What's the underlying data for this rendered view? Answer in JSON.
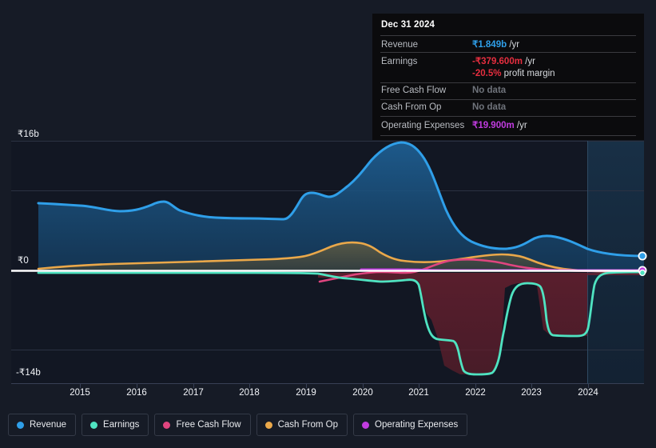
{
  "tooltip": {
    "date": "Dec 31 2024",
    "rows": [
      {
        "key": "Revenue",
        "value": "₹1.849b",
        "suffix": " /yr",
        "color": "blue"
      },
      {
        "key": "Earnings",
        "value": "-₹379.600m",
        "suffix": " /yr",
        "color": "red"
      },
      {
        "key": "",
        "value": "-20.5%",
        "suffix": " profit margin",
        "color": "red"
      },
      {
        "key": "Free Cash Flow",
        "value": "No data",
        "suffix": "",
        "color": "muted"
      },
      {
        "key": "Cash From Op",
        "value": "No data",
        "suffix": "",
        "color": "muted"
      },
      {
        "key": "Operating Expenses",
        "value": "₹19.900m",
        "suffix": " /yr",
        "color": "purple"
      }
    ]
  },
  "axis": {
    "y_top": "₹16b",
    "y_zero": "₹0",
    "y_bottom": "-₹14b",
    "x_labels": [
      "2015",
      "2016",
      "2017",
      "2018",
      "2019",
      "2020",
      "2021",
      "2022",
      "2023",
      "2024"
    ]
  },
  "legend": {
    "items": [
      {
        "label": "Revenue",
        "color": "#2f9fe9"
      },
      {
        "label": "Earnings",
        "color": "#4fe3c1"
      },
      {
        "label": "Free Cash Flow",
        "color": "#e0457f"
      },
      {
        "label": "Cash From Op",
        "color": "#eaa84a"
      },
      {
        "label": "Operating Expenses",
        "color": "#c13ce0"
      }
    ]
  },
  "chart_data": {
    "type": "area",
    "title": "",
    "xlabel": "",
    "ylabel": "",
    "currency": "INR",
    "ylim": [
      -14,
      16
    ],
    "y_ticks": [
      16,
      0,
      -14
    ],
    "grid": true,
    "legend_position": "bottom",
    "x": [
      2014.6,
      2015,
      2015.5,
      2016,
      2016.5,
      2017,
      2017.5,
      2018,
      2018.5,
      2019,
      2019.5,
      2020,
      2020.5,
      2021,
      2021.5,
      2022,
      2022.5,
      2023,
      2023.5,
      2024,
      2024.6
    ],
    "series": [
      {
        "name": "Revenue",
        "color": "#2f9fe9",
        "units": "billions INR",
        "values": [
          8.0,
          7.8,
          7.6,
          7.0,
          7.3,
          6.7,
          6.8,
          6.7,
          8.4,
          9.0,
          11.6,
          14.0,
          14.5,
          10.5,
          6.0,
          4.6,
          4.1,
          4.5,
          4.0,
          3.3,
          1.85
        ]
      },
      {
        "name": "Earnings",
        "color": "#4fe3c1",
        "units": "billions INR",
        "values": [
          -0.4,
          -0.4,
          -0.4,
          -0.4,
          -0.4,
          -0.4,
          -0.4,
          -0.4,
          -0.4,
          -0.4,
          -0.8,
          -0.9,
          -0.9,
          -0.6,
          -10.5,
          -12.6,
          -4.0,
          -1.2,
          -1.3,
          -6.0,
          -0.38
        ]
      },
      {
        "name": "Free Cash Flow",
        "color": "#e0457f",
        "units": "billions INR",
        "start_year": 2019,
        "values": [
          null,
          null,
          null,
          null,
          null,
          null,
          null,
          null,
          null,
          -1.3,
          -0.9,
          -0.4,
          -0.3,
          -0.1,
          0.4,
          0.6,
          0.5,
          0.3,
          0.2,
          0.2,
          0.2
        ]
      },
      {
        "name": "Cash From Op",
        "color": "#eaa84a",
        "units": "billions INR",
        "values": [
          0.2,
          0.4,
          0.5,
          0.6,
          0.7,
          0.7,
          0.7,
          0.8,
          0.9,
          1.0,
          1.6,
          2.1,
          1.6,
          1.3,
          1.2,
          1.2,
          1.4,
          1.4,
          0.8,
          0.6,
          0.5
        ]
      },
      {
        "name": "Operating Expenses",
        "color": "#c13ce0",
        "units": "billions INR",
        "start_year": 2020,
        "values": [
          null,
          null,
          null,
          null,
          null,
          null,
          null,
          null,
          null,
          null,
          null,
          0.45,
          0.45,
          0.45,
          0.45,
          0.45,
          0.45,
          0.45,
          0.45,
          0.45,
          0.42
        ]
      }
    ],
    "annotations": {
      "highlight_band": {
        "from": 2023.9,
        "to": 2024.6,
        "label": "latest period"
      },
      "endpoint_markers": true
    }
  }
}
